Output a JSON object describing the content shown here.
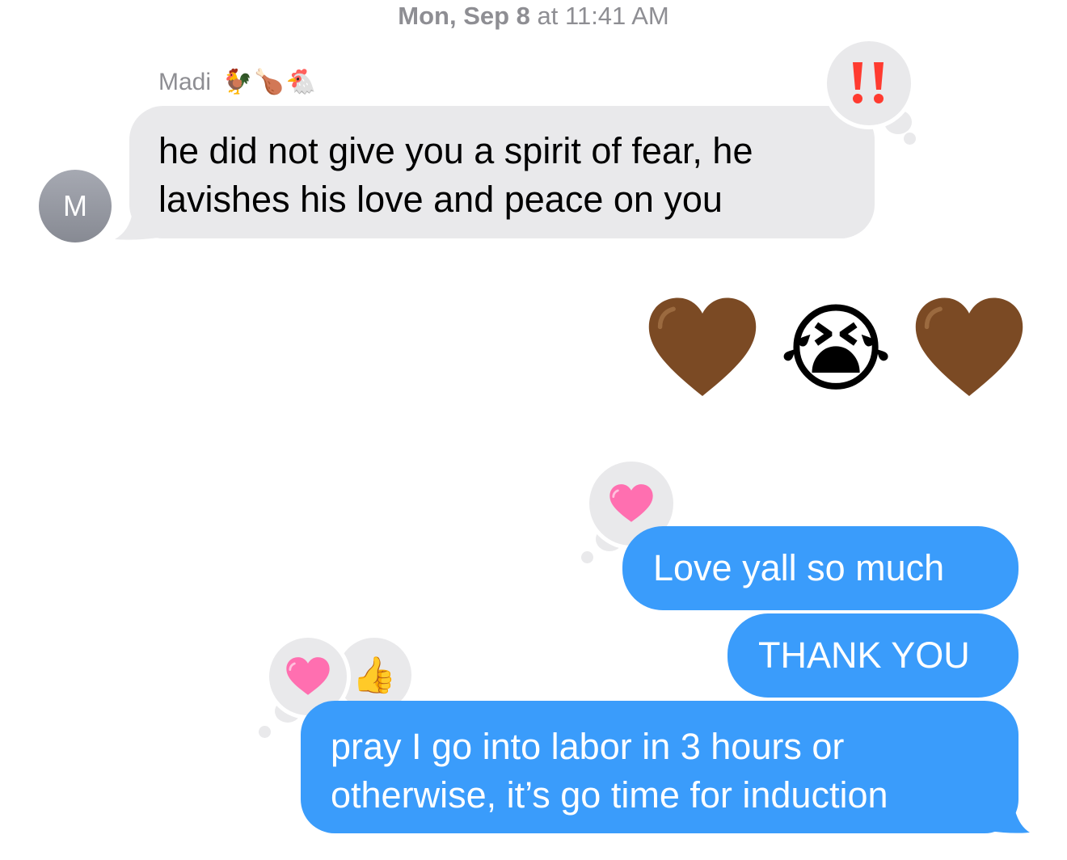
{
  "conversation": {
    "timestamp_day": "Mon, Sep 8",
    "timestamp_time": "at 11:41 AM",
    "sender": {
      "name": "Madi",
      "emoji_suffix": "🐓🍗🐔",
      "avatar_initial": "M"
    },
    "messages": [
      {
        "direction": "incoming",
        "text": "he did not give you a spirit of fear, he lavishes his love and peace on you",
        "reaction": "‼️"
      },
      {
        "direction": "outgoing",
        "emoji_message": [
          "🤎",
          "😭",
          "🤎"
        ]
      },
      {
        "direction": "outgoing",
        "text": "Love yall so much",
        "reaction": "🩷"
      },
      {
        "direction": "outgoing",
        "text": "THANK YOU"
      },
      {
        "direction": "outgoing",
        "text": "pray I go into labor in 3 hours or otherwise, it’s go time for induction",
        "reactions": [
          "🩷",
          "👍"
        ]
      }
    ]
  },
  "colors": {
    "incoming_bubble": "#e9e9eb",
    "outgoing_bubble": "#3a9cfb",
    "secondary_text": "#8e8e93",
    "reaction_exclaim": "#ff3b30",
    "brown_heart": "#7b4a24",
    "pink_heart": "#ff5fa8"
  }
}
